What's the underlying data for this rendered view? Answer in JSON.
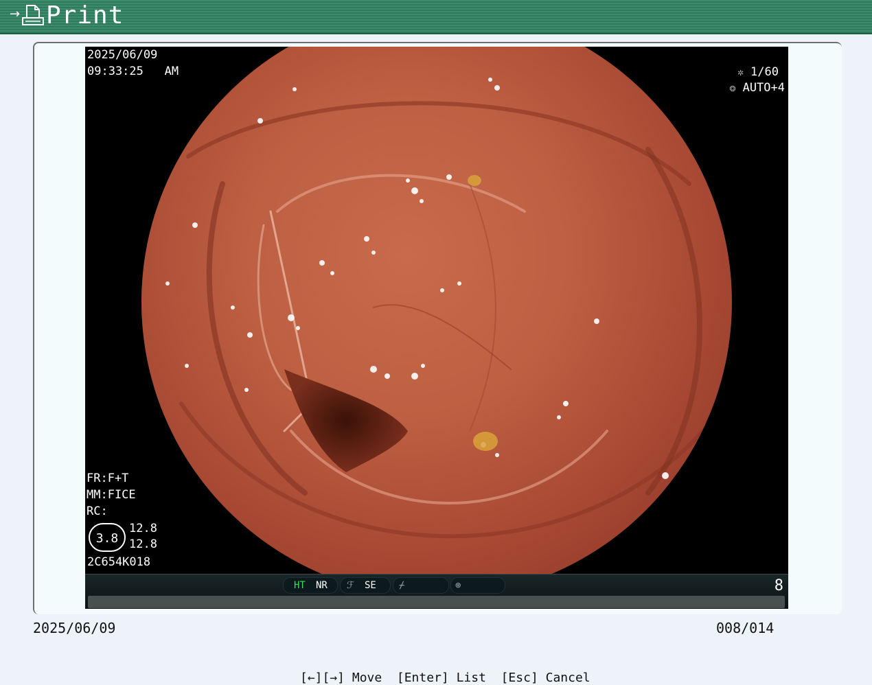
{
  "header": {
    "title": "Print",
    "icon": "print-icon"
  },
  "overlay": {
    "date": "2025/06/09",
    "time": "09:33:25   AM",
    "shutter": "1/60",
    "iris": "AUTO+4",
    "fr": "FR:F+T",
    "mm": "MM:FICE",
    "rc": "RC:",
    "zoom": "3.8",
    "value_1": "12.8",
    "value_2": "12.8",
    "scope_code": "2C654K018"
  },
  "status_bar": {
    "ht": "HT",
    "nr": "NR",
    "se": "SE",
    "number": "8"
  },
  "footer": {
    "date": "2025/06/09",
    "counter": "008/014",
    "hints": "[←][→] Move  [Enter] List  [Esc] Cancel"
  },
  "colors": {
    "header": "#2f7a5c",
    "tissue": "#b3553a",
    "background": "#eef3f9"
  }
}
